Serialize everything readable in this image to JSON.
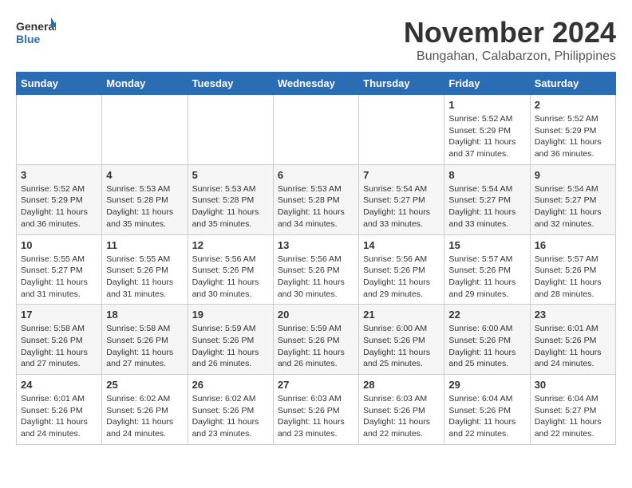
{
  "logo": {
    "line1": "General",
    "line2": "Blue"
  },
  "title": "November 2024",
  "location": "Bungahan, Calabarzon, Philippines",
  "weekdays": [
    "Sunday",
    "Monday",
    "Tuesday",
    "Wednesday",
    "Thursday",
    "Friday",
    "Saturday"
  ],
  "weeks": [
    [
      {
        "day": "",
        "info": ""
      },
      {
        "day": "",
        "info": ""
      },
      {
        "day": "",
        "info": ""
      },
      {
        "day": "",
        "info": ""
      },
      {
        "day": "",
        "info": ""
      },
      {
        "day": "1",
        "info": "Sunrise: 5:52 AM\nSunset: 5:29 PM\nDaylight: 11 hours and 37 minutes."
      },
      {
        "day": "2",
        "info": "Sunrise: 5:52 AM\nSunset: 5:29 PM\nDaylight: 11 hours and 36 minutes."
      }
    ],
    [
      {
        "day": "3",
        "info": "Sunrise: 5:52 AM\nSunset: 5:29 PM\nDaylight: 11 hours and 36 minutes."
      },
      {
        "day": "4",
        "info": "Sunrise: 5:53 AM\nSunset: 5:28 PM\nDaylight: 11 hours and 35 minutes."
      },
      {
        "day": "5",
        "info": "Sunrise: 5:53 AM\nSunset: 5:28 PM\nDaylight: 11 hours and 35 minutes."
      },
      {
        "day": "6",
        "info": "Sunrise: 5:53 AM\nSunset: 5:28 PM\nDaylight: 11 hours and 34 minutes."
      },
      {
        "day": "7",
        "info": "Sunrise: 5:54 AM\nSunset: 5:27 PM\nDaylight: 11 hours and 33 minutes."
      },
      {
        "day": "8",
        "info": "Sunrise: 5:54 AM\nSunset: 5:27 PM\nDaylight: 11 hours and 33 minutes."
      },
      {
        "day": "9",
        "info": "Sunrise: 5:54 AM\nSunset: 5:27 PM\nDaylight: 11 hours and 32 minutes."
      }
    ],
    [
      {
        "day": "10",
        "info": "Sunrise: 5:55 AM\nSunset: 5:27 PM\nDaylight: 11 hours and 31 minutes."
      },
      {
        "day": "11",
        "info": "Sunrise: 5:55 AM\nSunset: 5:26 PM\nDaylight: 11 hours and 31 minutes."
      },
      {
        "day": "12",
        "info": "Sunrise: 5:56 AM\nSunset: 5:26 PM\nDaylight: 11 hours and 30 minutes."
      },
      {
        "day": "13",
        "info": "Sunrise: 5:56 AM\nSunset: 5:26 PM\nDaylight: 11 hours and 30 minutes."
      },
      {
        "day": "14",
        "info": "Sunrise: 5:56 AM\nSunset: 5:26 PM\nDaylight: 11 hours and 29 minutes."
      },
      {
        "day": "15",
        "info": "Sunrise: 5:57 AM\nSunset: 5:26 PM\nDaylight: 11 hours and 29 minutes."
      },
      {
        "day": "16",
        "info": "Sunrise: 5:57 AM\nSunset: 5:26 PM\nDaylight: 11 hours and 28 minutes."
      }
    ],
    [
      {
        "day": "17",
        "info": "Sunrise: 5:58 AM\nSunset: 5:26 PM\nDaylight: 11 hours and 27 minutes."
      },
      {
        "day": "18",
        "info": "Sunrise: 5:58 AM\nSunset: 5:26 PM\nDaylight: 11 hours and 27 minutes."
      },
      {
        "day": "19",
        "info": "Sunrise: 5:59 AM\nSunset: 5:26 PM\nDaylight: 11 hours and 26 minutes."
      },
      {
        "day": "20",
        "info": "Sunrise: 5:59 AM\nSunset: 5:26 PM\nDaylight: 11 hours and 26 minutes."
      },
      {
        "day": "21",
        "info": "Sunrise: 6:00 AM\nSunset: 5:26 PM\nDaylight: 11 hours and 25 minutes."
      },
      {
        "day": "22",
        "info": "Sunrise: 6:00 AM\nSunset: 5:26 PM\nDaylight: 11 hours and 25 minutes."
      },
      {
        "day": "23",
        "info": "Sunrise: 6:01 AM\nSunset: 5:26 PM\nDaylight: 11 hours and 24 minutes."
      }
    ],
    [
      {
        "day": "24",
        "info": "Sunrise: 6:01 AM\nSunset: 5:26 PM\nDaylight: 11 hours and 24 minutes."
      },
      {
        "day": "25",
        "info": "Sunrise: 6:02 AM\nSunset: 5:26 PM\nDaylight: 11 hours and 24 minutes."
      },
      {
        "day": "26",
        "info": "Sunrise: 6:02 AM\nSunset: 5:26 PM\nDaylight: 11 hours and 23 minutes."
      },
      {
        "day": "27",
        "info": "Sunrise: 6:03 AM\nSunset: 5:26 PM\nDaylight: 11 hours and 23 minutes."
      },
      {
        "day": "28",
        "info": "Sunrise: 6:03 AM\nSunset: 5:26 PM\nDaylight: 11 hours and 22 minutes."
      },
      {
        "day": "29",
        "info": "Sunrise: 6:04 AM\nSunset: 5:26 PM\nDaylight: 11 hours and 22 minutes."
      },
      {
        "day": "30",
        "info": "Sunrise: 6:04 AM\nSunset: 5:27 PM\nDaylight: 11 hours and 22 minutes."
      }
    ]
  ]
}
